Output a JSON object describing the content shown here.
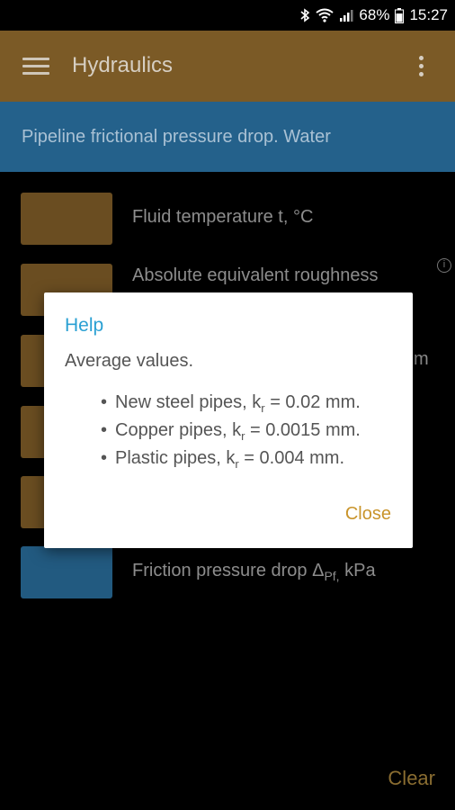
{
  "status_bar": {
    "battery": "68%",
    "time": "15:27"
  },
  "app_bar": {
    "title": "Hydraulics"
  },
  "banner": {
    "text": "Pipeline frictional pressure drop. Water"
  },
  "rows": [
    {
      "label": "Fluid temperature t, °C"
    },
    {
      "label": "Absolute equivalent roughness"
    },
    {
      "label_partial": "m"
    },
    {
      "label": ""
    },
    {
      "label": ""
    },
    {
      "label_main": "Friction pressure drop Δ",
      "label_sub": "Pf,",
      "label_end": " kPa"
    }
  ],
  "clear_label": "Clear",
  "dialog": {
    "title": "Help",
    "text": "Average values.",
    "items": [
      {
        "pre": "New steel pipes, k",
        "sub": "r",
        "post": " = 0.02 mm."
      },
      {
        "pre": "Copper pipes, k",
        "sub": "r",
        "post": " = 0.0015 mm."
      },
      {
        "pre": "Plastic pipes, k",
        "sub": "r",
        "post": " = 0.004 mm."
      }
    ],
    "close_label": "Close"
  },
  "colors": {
    "app_bar": "#7b5a26",
    "banner": "#24618b",
    "input_box": "#6a4d21",
    "result_box": "#225a80",
    "dialog_title": "#2aa0d3",
    "dialog_button": "#c9942b"
  }
}
